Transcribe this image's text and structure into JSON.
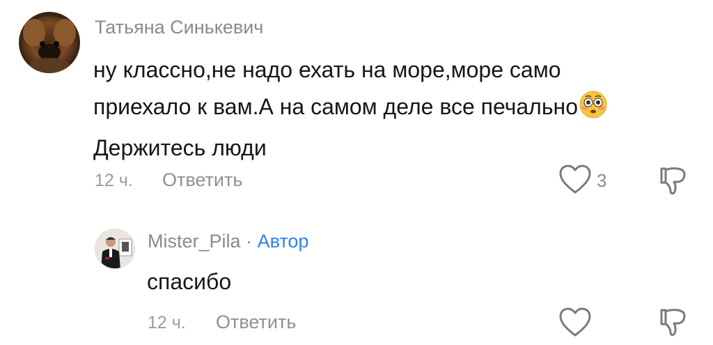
{
  "comments": [
    {
      "author": "Татьяна Синькевич",
      "text_lines": [
        "ну классно,не надо ехать на море,море само",
        "приехало к вам.А на самом деле все печально",
        "Держитесь люди"
      ],
      "emoji": "flushed-face",
      "time": "12 ч.",
      "reply_label": "Ответить",
      "like_count": "3"
    },
    {
      "author": "Mister_Pila",
      "separator": "·",
      "badge": "Автор",
      "text_lines": [
        "спасибо"
      ],
      "time": "12 ч.",
      "reply_label": "Ответить",
      "like_count": ""
    }
  ],
  "colors": {
    "author": "#8a8a8a",
    "badge": "#2f80ed",
    "text": "#161616",
    "meta": "#9b9b9b",
    "icon": "#7a7a7a"
  },
  "icons": {
    "like": "heart-outline-icon",
    "dislike": "thumbs-down-outline-icon"
  }
}
